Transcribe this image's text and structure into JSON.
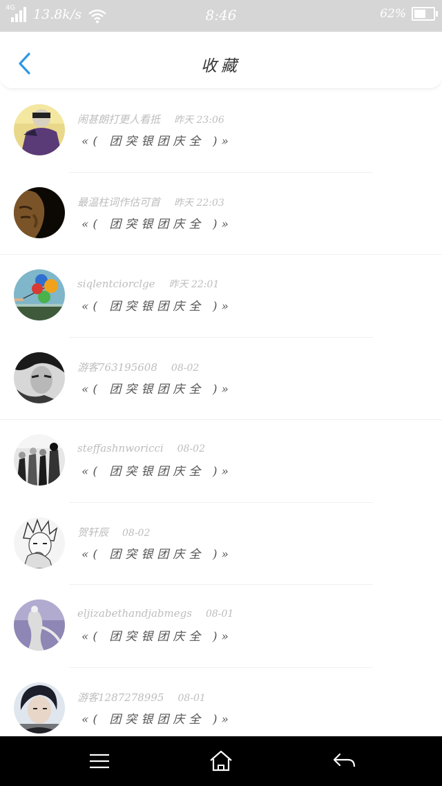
{
  "status_bar": {
    "network": "4G",
    "speed": "13.8k/s",
    "time": "8:46",
    "battery": "62%",
    "battery_level": 0.62,
    "icons": [
      "signal-icon",
      "wifi-icon",
      "battery-icon"
    ]
  },
  "header": {
    "title": "收藏",
    "back_icon": "chevron-left-icon",
    "accent_color": "#2b97e8"
  },
  "favorites": [
    {
      "user": "闹甚朗打更人看抵",
      "time": "昨天 23:06",
      "text": "«( 团突银团庆全 )»"
    },
    {
      "user": "最温柱词作估可首",
      "time": "昨天 22:03",
      "text": "«( 团突银团庆全 )»"
    },
    {
      "user": "siqlentciorclge",
      "time": "昨天 22:01",
      "text": "«( 团突银团庆全 )»"
    },
    {
      "user": "游客763195608",
      "time": "08-02",
      "text": "«( 团突银团庆全 )»"
    },
    {
      "user": "steffashnworicci",
      "time": "08-02",
      "text": "«( 团突银团庆全 )»"
    },
    {
      "user": "贺轩辰",
      "time": "08-02",
      "text": "«( 团突银团庆全 )»"
    },
    {
      "user": "eljizabethandjabmegs",
      "time": "08-01",
      "text": "«( 团突银团庆全 )»"
    },
    {
      "user": "游客1287278995",
      "time": "08-01",
      "text": "«( 团突银团庆全 )»"
    }
  ],
  "nav_bar": {
    "icons": [
      "menu-icon",
      "home-icon",
      "back-arrow-icon"
    ]
  }
}
